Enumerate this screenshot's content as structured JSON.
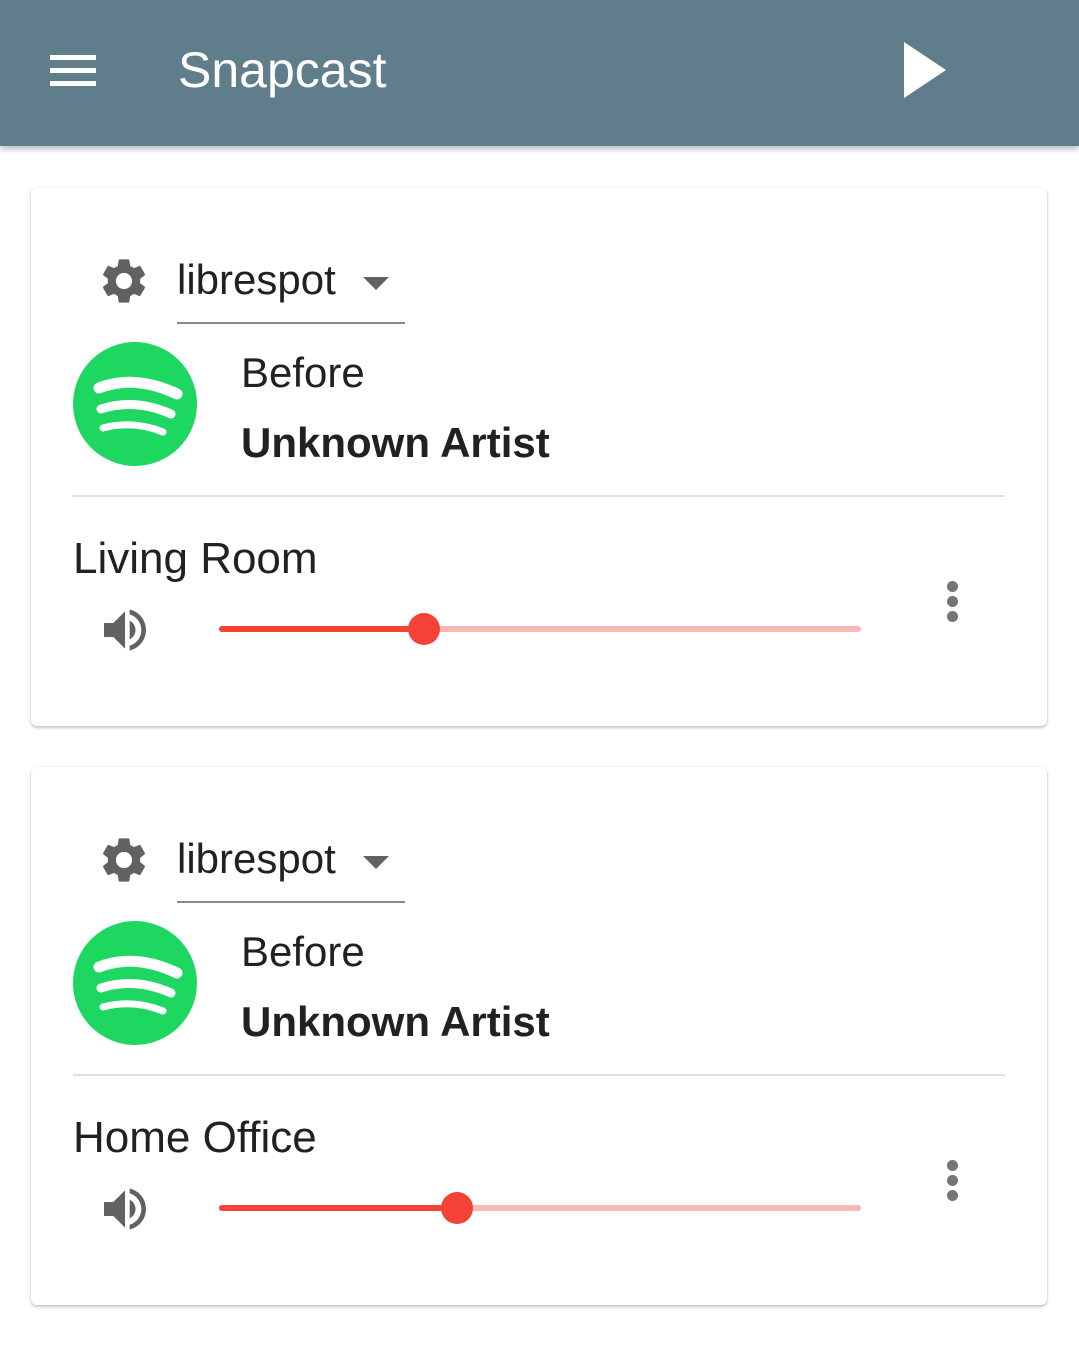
{
  "app_bar": {
    "title": "Snapcast",
    "menu_icon": "menu-icon",
    "play_icon": "play-icon"
  },
  "colors": {
    "app_bar": "#607d8b",
    "accent": "#f44336",
    "accent_light": "#f7b7b3",
    "spotify_green": "#1ed760",
    "icon_gray": "#757575"
  },
  "groups": [
    {
      "stream": {
        "name": "librespot"
      },
      "now_playing": {
        "title": "Before",
        "artist": "Unknown Artist",
        "art_icon": "spotify-logo-icon"
      },
      "client": {
        "name": "Living Room",
        "volume_percent": 32
      }
    },
    {
      "stream": {
        "name": "librespot"
      },
      "now_playing": {
        "title": "Before",
        "artist": "Unknown Artist",
        "art_icon": "spotify-logo-icon"
      },
      "client": {
        "name": "Home Office",
        "volume_percent": 37
      }
    }
  ]
}
